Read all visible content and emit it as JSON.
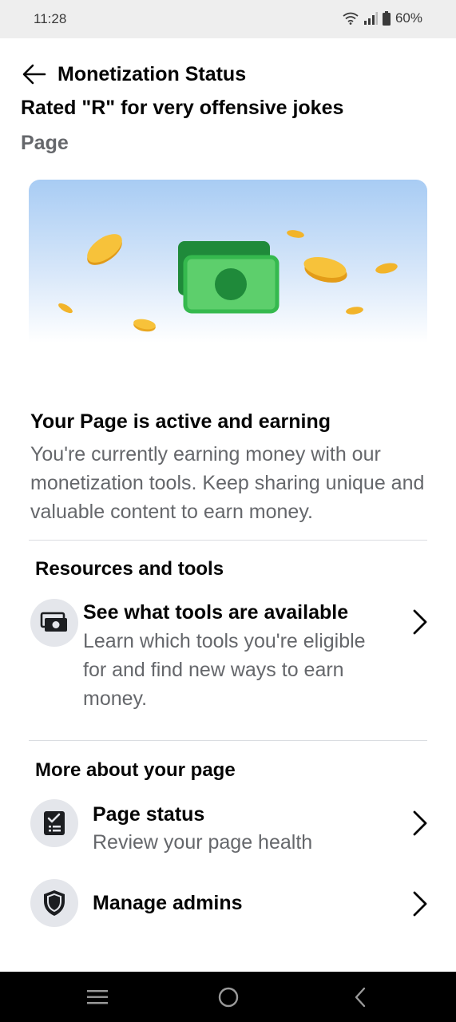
{
  "status_bar": {
    "time": "11:28",
    "battery": "60%"
  },
  "header": {
    "title": "Monetization Status",
    "back_icon": "arrow-left-icon"
  },
  "page": {
    "name": "Rated \"R\" for very offensive jokes",
    "type": "Page"
  },
  "hero": {
    "illustration": "money-coins-illustration"
  },
  "status": {
    "title": "Your Page is active and earning",
    "description": "You're currently earning money with our monetization tools. Keep sharing unique and valuable content to earn money."
  },
  "resources": {
    "heading": "Resources and tools",
    "items": [
      {
        "title": "See what tools are available",
        "subtitle": "Learn which tools you're eligible for and find new ways to earn money.",
        "icon": "money-tools-icon"
      }
    ]
  },
  "more": {
    "heading": "More about your page",
    "items": [
      {
        "title": "Page status",
        "subtitle": "Review your page health",
        "icon": "checklist-icon"
      },
      {
        "title": "Manage admins",
        "subtitle": "",
        "icon": "shield-icon"
      }
    ]
  },
  "colors": {
    "primary_text": "#050505",
    "secondary_text": "#65676b",
    "icon_bg": "#e4e6eb",
    "coin": "#f5b82e",
    "bill": "#35b94e"
  }
}
